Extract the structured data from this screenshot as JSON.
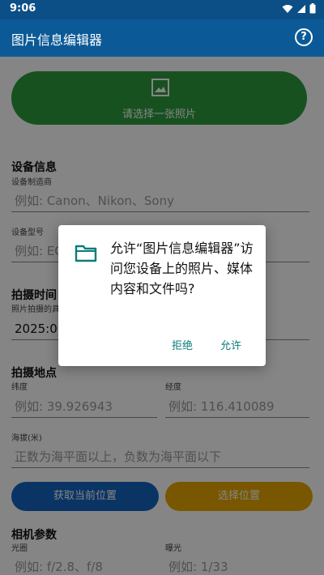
{
  "status_bar": {
    "time": "9:06"
  },
  "app_bar": {
    "title": "图片信息编辑器",
    "help_icon": "?"
  },
  "photo_picker": {
    "label": "请选择一张照片"
  },
  "device_info": {
    "section": "设备信息",
    "maker_label": "设备制造商",
    "maker_placeholder": "例如: Canon、Nikon、Sony",
    "model_label": "设备型号",
    "model_placeholder": "例如: EO"
  },
  "capture_time": {
    "section": "拍摄时间",
    "label": "照片拍摄的具",
    "value": "2025:06"
  },
  "location": {
    "section": "拍摄地点",
    "lat_label": "纬度",
    "lat_placeholder": "例如: 39.926943",
    "lng_label": "经度",
    "lng_placeholder": "例如: 116.410089",
    "alt_label": "海拔(米)",
    "alt_placeholder": "正数为海平面以上，负数为海平面以下",
    "get_location_button": "获取当前位置",
    "choose_location_button": "选择位置"
  },
  "camera_params": {
    "section": "相机参数",
    "aperture_label": "光圈",
    "aperture_placeholder": "例如: f/2.8、f/8",
    "exposure_label": "曝光",
    "exposure_placeholder": "例如: 1/33"
  },
  "permission_dialog": {
    "message": "允许“图片信息编辑器”访问您设备上的照片、媒体内容和文件吗?",
    "deny": "拒绝",
    "allow": "允许"
  },
  "colors": {
    "app_bar": "#0b5a97",
    "green_button": "#2e9b3f",
    "blue_button": "#1565c0",
    "yellow_button": "#e6a800",
    "dialog_accent": "#0a7d7a"
  }
}
